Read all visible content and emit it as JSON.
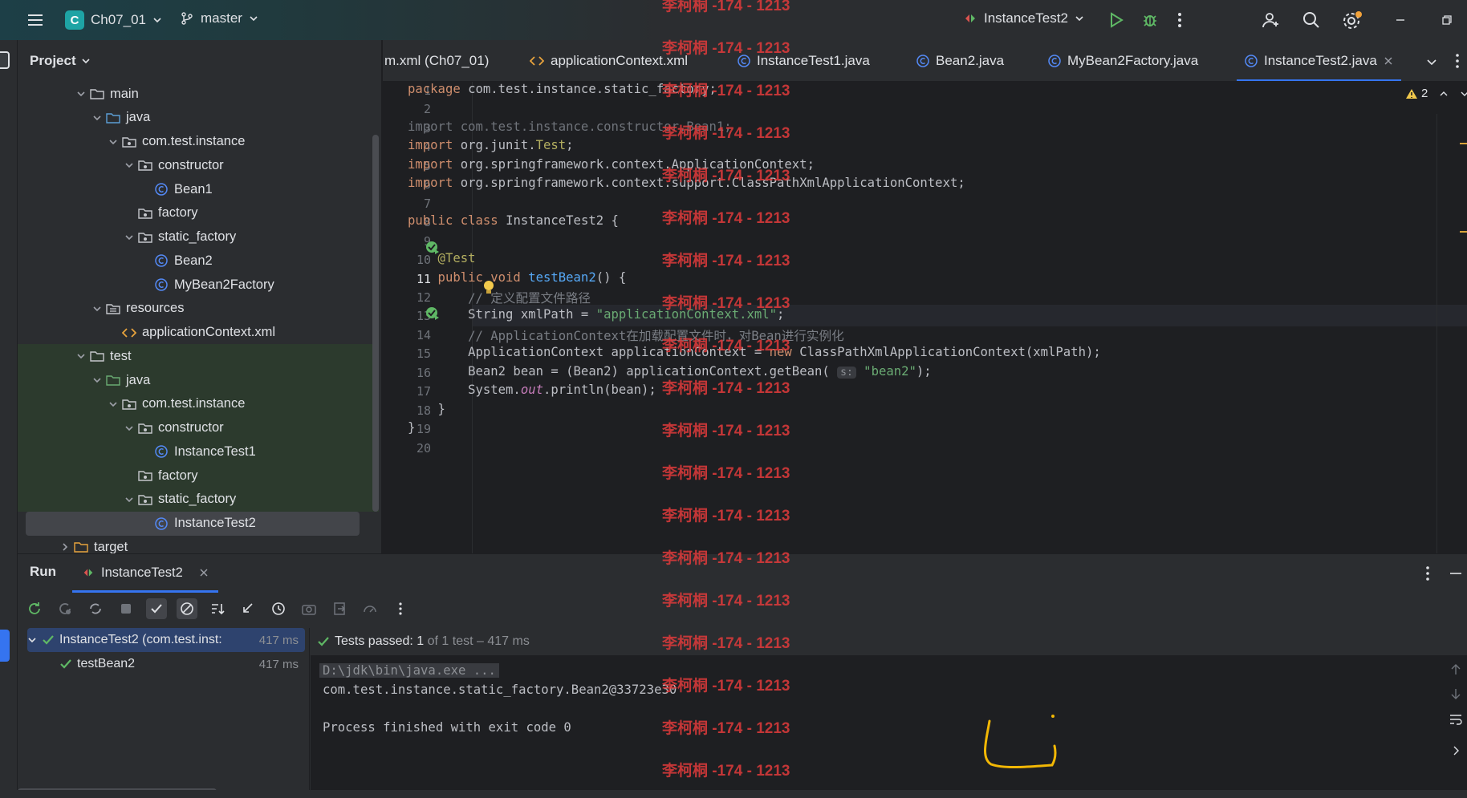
{
  "titlebar": {
    "project_badge": "C",
    "project_name": "Ch07_01",
    "branch": "master",
    "run_config": "InstanceTest2"
  },
  "project_pane": {
    "title": "Project",
    "tree": [
      {
        "label": "main",
        "icon": "folder-icon",
        "indent": 3,
        "expanded": true
      },
      {
        "label": "java",
        "icon": "source-folder-icon",
        "indent": 4,
        "expanded": true
      },
      {
        "label": "com.test.instance",
        "icon": "package-icon",
        "indent": 5,
        "expanded": true
      },
      {
        "label": "constructor",
        "icon": "package-icon",
        "indent": 6,
        "expanded": true
      },
      {
        "label": "Bean1",
        "icon": "class-icon",
        "indent": 7
      },
      {
        "label": "factory",
        "icon": "package-icon",
        "indent": 6
      },
      {
        "label": "static_factory",
        "icon": "package-icon",
        "indent": 6,
        "expanded": true
      },
      {
        "label": "Bean2",
        "icon": "class-icon",
        "indent": 7
      },
      {
        "label": "MyBean2Factory",
        "icon": "class-icon",
        "indent": 7
      },
      {
        "label": "resources",
        "icon": "resources-folder-icon",
        "indent": 4,
        "expanded": true
      },
      {
        "label": "applicationContext.xml",
        "icon": "xml-file-icon",
        "indent": 5
      },
      {
        "label": "test",
        "icon": "folder-icon",
        "indent": 3,
        "expanded": true
      },
      {
        "label": "java",
        "icon": "test-source-folder-icon",
        "indent": 4,
        "expanded": true
      },
      {
        "label": "com.test.instance",
        "icon": "package-icon",
        "indent": 5,
        "expanded": true
      },
      {
        "label": "constructor",
        "icon": "package-icon",
        "indent": 6,
        "expanded": true
      },
      {
        "label": "InstanceTest1",
        "icon": "class-icon",
        "indent": 7
      },
      {
        "label": "factory",
        "icon": "package-icon",
        "indent": 6
      },
      {
        "label": "static_factory",
        "icon": "package-icon",
        "indent": 6,
        "expanded": true
      },
      {
        "label": "InstanceTest2",
        "icon": "class-icon",
        "indent": 7,
        "selected": true
      },
      {
        "label": "target",
        "icon": "excluded-folder-icon",
        "indent": 2
      }
    ]
  },
  "tabs": [
    {
      "label": "m.xml (Ch07_01)",
      "icon": "none"
    },
    {
      "label": "applicationContext.xml",
      "icon": "xml-file-icon"
    },
    {
      "label": "InstanceTest1.java",
      "icon": "class-icon"
    },
    {
      "label": "Bean2.java",
      "icon": "class-icon"
    },
    {
      "label": "MyBean2Factory.java",
      "icon": "class-icon"
    },
    {
      "label": "InstanceTest2.java",
      "icon": "class-icon",
      "active": true
    }
  ],
  "editor": {
    "warning_count": "2",
    "current_line": 11,
    "lines": [
      [
        [
          "kw",
          "package "
        ],
        [
          "",
          "com.test.instance.static_factory;"
        ]
      ],
      [],
      [
        [
          "dim",
          "import com.test.instance.constructor.Bean1;"
        ]
      ],
      [
        [
          "kw",
          "import "
        ],
        [
          "",
          "org.junit."
        ],
        [
          "an",
          "Test"
        ],
        [
          "",
          ";"
        ]
      ],
      [
        [
          "kw",
          "import "
        ],
        [
          "",
          "org.springframework.context.ApplicationContext;"
        ]
      ],
      [
        [
          "kw",
          "import "
        ],
        [
          "",
          "org.springframework.context.support.ClassPathXmlApplicationContext;"
        ]
      ],
      [],
      [
        [
          "kw",
          "public class "
        ],
        [
          "",
          "InstanceTest2 {"
        ]
      ],
      [],
      [
        [
          "an",
          "    @Test"
        ]
      ],
      [
        [
          "kw",
          "    public void "
        ],
        [
          "fn",
          "testBean2"
        ],
        [
          "",
          "() {"
        ]
      ],
      [
        [
          "cm",
          "        // 定义配置文件路径"
        ]
      ],
      [
        [
          "",
          "        String xmlPath = "
        ],
        [
          "str",
          "\"applicationContext.xml\""
        ],
        [
          "",
          ";"
        ]
      ],
      [
        [
          "cm",
          "        // ApplicationContext在加载配置文件时，对Bean进行实例化"
        ]
      ],
      [
        [
          "",
          "        ApplicationContext applicationContext = "
        ],
        [
          "kw",
          "new "
        ],
        [
          "",
          "ClassPathXmlApplicationContext(xmlPath);"
        ]
      ],
      [
        [
          "",
          "        Bean2 bean = (Bean2) applicationContext.getBean( "
        ],
        [
          "hint",
          "s:"
        ],
        [
          "str",
          " \"bean2\""
        ],
        [
          "",
          ");"
        ]
      ],
      [
        [
          "",
          "        System."
        ],
        [
          "st",
          "out"
        ],
        [
          "",
          ".println(bean);"
        ]
      ],
      [
        [
          "",
          "    }"
        ]
      ],
      [
        [
          "",
          "}"
        ]
      ],
      []
    ]
  },
  "run_panel": {
    "title": "Run",
    "tab_label": "InstanceTest2",
    "status_prefix": "Tests passed: ",
    "status_count": "1",
    "status_suffix": " of 1 test – 417 ms",
    "tree": [
      {
        "label": "InstanceTest2 (com.test.inst:",
        "time": "417 ms",
        "selected": true
      },
      {
        "label": "testBean2",
        "time": "417 ms"
      }
    ],
    "console": [
      "D:\\jdk\\bin\\java.exe ...",
      "com.test.instance.static_factory.Bean2@33723e30",
      "",
      "Process finished with exit code 0"
    ]
  },
  "watermark": "李柯桐 -174 - 1213",
  "colors": {
    "accent": "#3574f0",
    "pass_green": "#5fb865",
    "watermark_red": "#e03b3b",
    "annotation_yellow": "#f2b705"
  }
}
